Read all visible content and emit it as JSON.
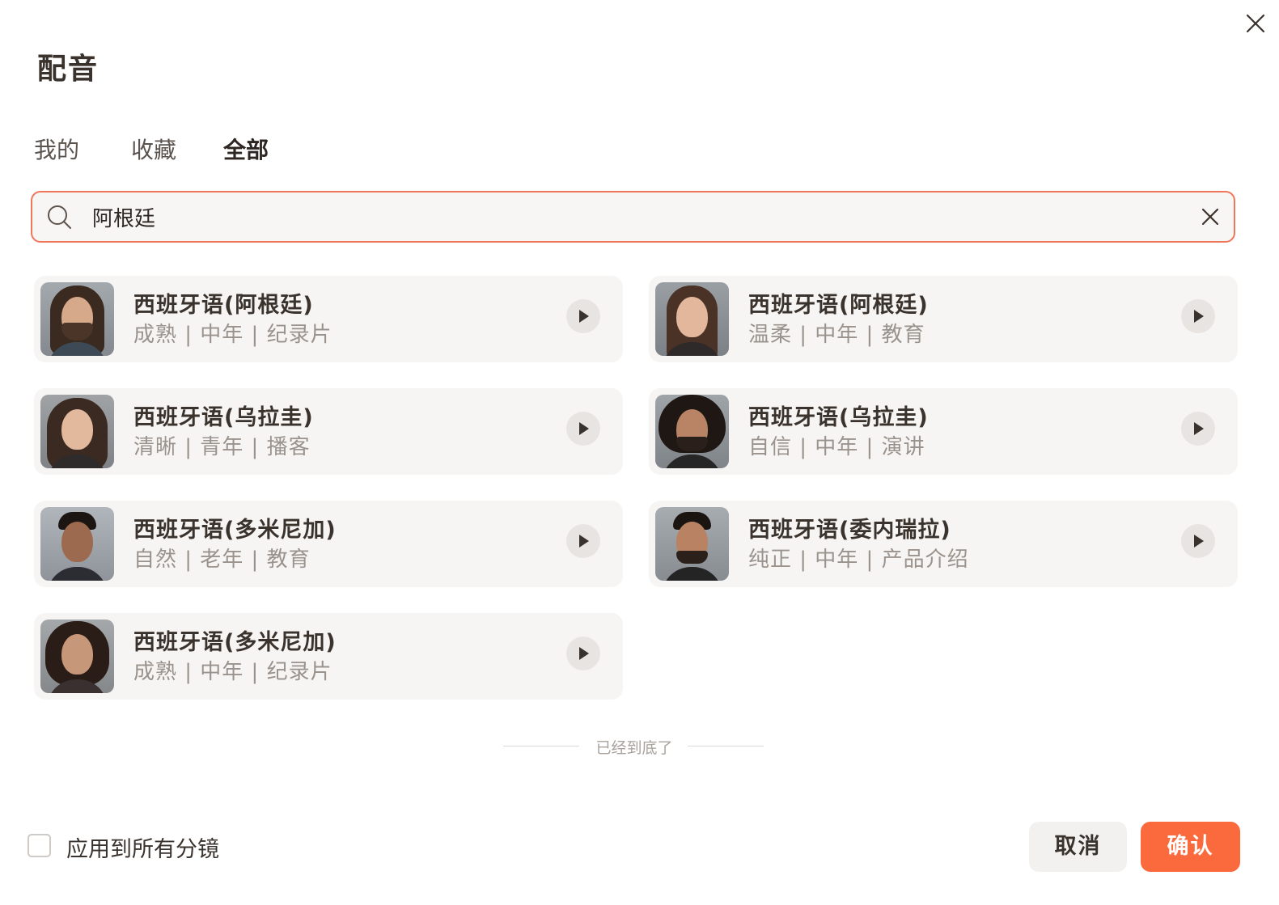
{
  "dialog": {
    "title": "配音"
  },
  "tabs": [
    {
      "label": "我的",
      "active": false
    },
    {
      "label": "收藏",
      "active": false
    },
    {
      "label": "全部",
      "active": true
    }
  ],
  "search": {
    "value": "阿根廷",
    "placeholder": ""
  },
  "voices": [
    {
      "name": "西班牙语(阿根廷)",
      "tags": "成熟 | 中年 | 纪录片",
      "avatar": "male-beard-long-hair"
    },
    {
      "name": "西班牙语(阿根廷)",
      "tags": "温柔 | 中年 | 教育",
      "avatar": "female-long-hair"
    },
    {
      "name": "西班牙语(乌拉圭)",
      "tags": "清晰 | 青年 | 播客",
      "avatar": "female-wavy-hair"
    },
    {
      "name": "西班牙语(乌拉圭)",
      "tags": "自信 | 中年 | 演讲",
      "avatar": "male-curly-hair"
    },
    {
      "name": "西班牙语(多米尼加)",
      "tags": "自然 | 老年 | 教育",
      "avatar": "male-short-hair"
    },
    {
      "name": "西班牙语(委内瑞拉)",
      "tags": "纯正 | 中年 | 产品介绍",
      "avatar": "male-short-hair-beard"
    },
    {
      "name": "西班牙语(多米尼加)",
      "tags": "成熟 | 中年 | 纪录片",
      "avatar": "female-curly-hair"
    }
  ],
  "list_end_text": "已经到底了",
  "footer": {
    "apply_all_label": "应用到所有分镜",
    "apply_all_checked": false,
    "cancel_label": "取消",
    "confirm_label": "确认"
  },
  "colors": {
    "accent": "#fb6a3c",
    "search_border": "#f0765a",
    "card_bg": "#f7f5f3"
  }
}
